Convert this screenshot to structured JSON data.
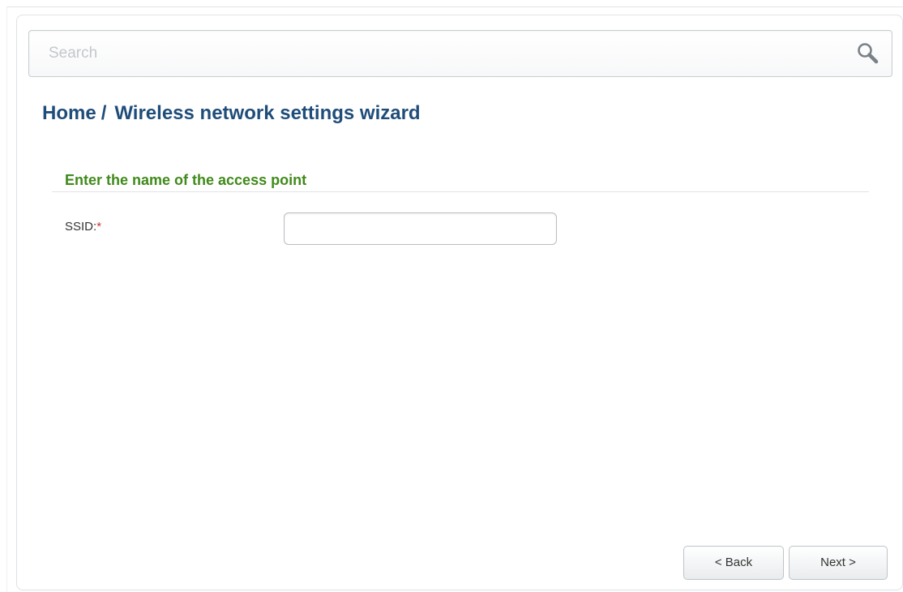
{
  "search": {
    "placeholder": "Search",
    "icon": "search-icon"
  },
  "breadcrumb": {
    "home": "Home",
    "separator": "/",
    "current": "Wireless network settings wizard"
  },
  "section": {
    "title": "Enter the name of the access point"
  },
  "form": {
    "ssid_label": "SSID:",
    "required_mark": "*",
    "ssid_value": ""
  },
  "buttons": {
    "back": "< Back",
    "next": "Next >"
  },
  "colors": {
    "title": "#1f4d7a",
    "section_title": "#3f8a1a",
    "required": "#d03030"
  }
}
